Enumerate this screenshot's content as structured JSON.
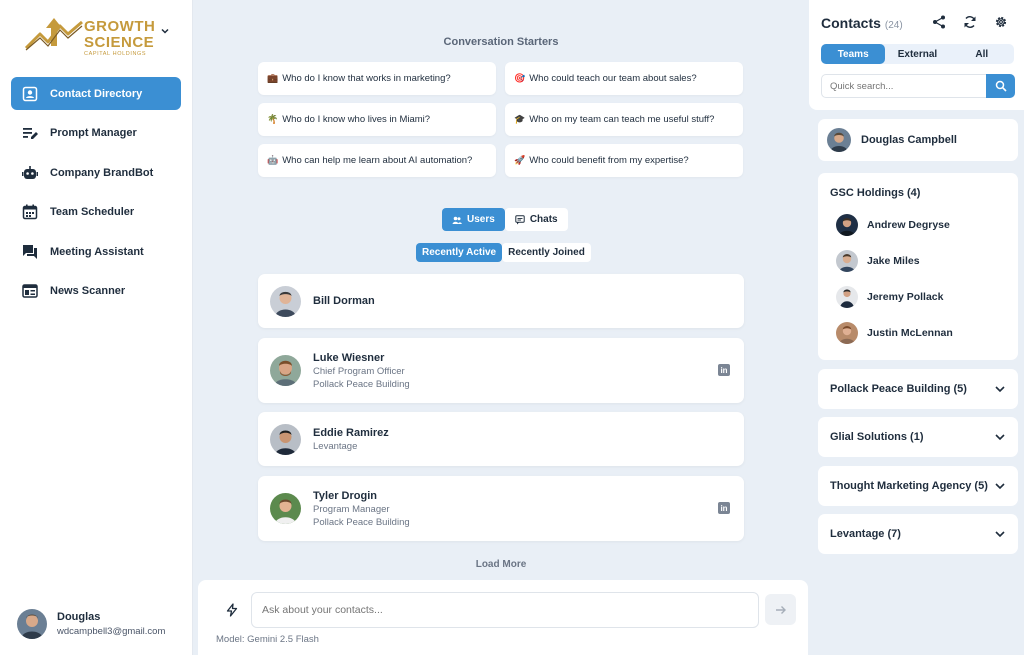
{
  "brand": {
    "line1": "GROWTH",
    "line2": "SCIENCE",
    "line3": "CAPITAL HOLDINGS",
    "gold_color": "#c59a3c"
  },
  "sidebar": {
    "items": [
      {
        "label": "Contact Directory",
        "icon": "contact-card-icon",
        "active": true
      },
      {
        "label": "Prompt Manager",
        "icon": "edit-list-icon"
      },
      {
        "label": "Company BrandBot",
        "icon": "robot-icon"
      },
      {
        "label": "Team Scheduler",
        "icon": "calendar-icon"
      },
      {
        "label": "Meeting Assistant",
        "icon": "chat-bubbles-icon"
      },
      {
        "label": "News Scanner",
        "icon": "newspaper-icon"
      }
    ],
    "user": {
      "name": "Douglas",
      "email": "wdcampbell3@gmail.com"
    }
  },
  "main": {
    "starters_title": "Conversation Starters",
    "starters": [
      {
        "emoji": "💼",
        "text": "Who do I know that works in marketing?"
      },
      {
        "emoji": "🎯",
        "text": "Who could teach our team about sales?"
      },
      {
        "emoji": "🌴",
        "text": "Who do I know who lives in Miami?"
      },
      {
        "emoji": "🎓",
        "text": "Who on my team can teach me useful stuff?"
      },
      {
        "emoji": "🤖",
        "text": "Who can help me learn about AI automation?"
      },
      {
        "emoji": "🚀",
        "text": "Who could benefit from my expertise?"
      }
    ],
    "view_toggle": {
      "users": "Users",
      "chats": "Chats"
    },
    "sort_toggle": {
      "recent_active": "Recently Active",
      "recent_joined": "Recently Joined"
    },
    "contacts": [
      {
        "name": "Bill Dorman",
        "title": "",
        "org": "",
        "linkedin": false
      },
      {
        "name": "Luke Wiesner",
        "title": "Chief Program Officer",
        "org": "Pollack Peace Building",
        "linkedin": true
      },
      {
        "name": "Eddie Ramirez",
        "title": "Levantage",
        "org": "",
        "linkedin": false
      },
      {
        "name": "Tyler Drogin",
        "title": "Program Manager",
        "org": "Pollack Peace Building",
        "linkedin": true
      }
    ],
    "load_more": "Load More",
    "chat": {
      "placeholder": "Ask about your contacts...",
      "model": "Model: Gemini 2.5 Flash"
    }
  },
  "right": {
    "title": "Contacts",
    "count": "(24)",
    "tabs": [
      "Teams",
      "External",
      "All"
    ],
    "search_placeholder": "Quick search...",
    "me": "Douglas Campbell",
    "open_group": {
      "title": "GSC Holdings (4)",
      "members": [
        "Andrew Degryse",
        "Jake Miles",
        "Jeremy Pollack",
        "Justin McLennan"
      ]
    },
    "groups": [
      "Pollack Peace Building (5)",
      "Glial Solutions (1)",
      "Thought Marketing Agency (5)",
      "Levantage (7)"
    ]
  },
  "colors": {
    "accent": "#3b8fd3",
    "background": "#e9eff6",
    "text": "#1f2d3d"
  }
}
